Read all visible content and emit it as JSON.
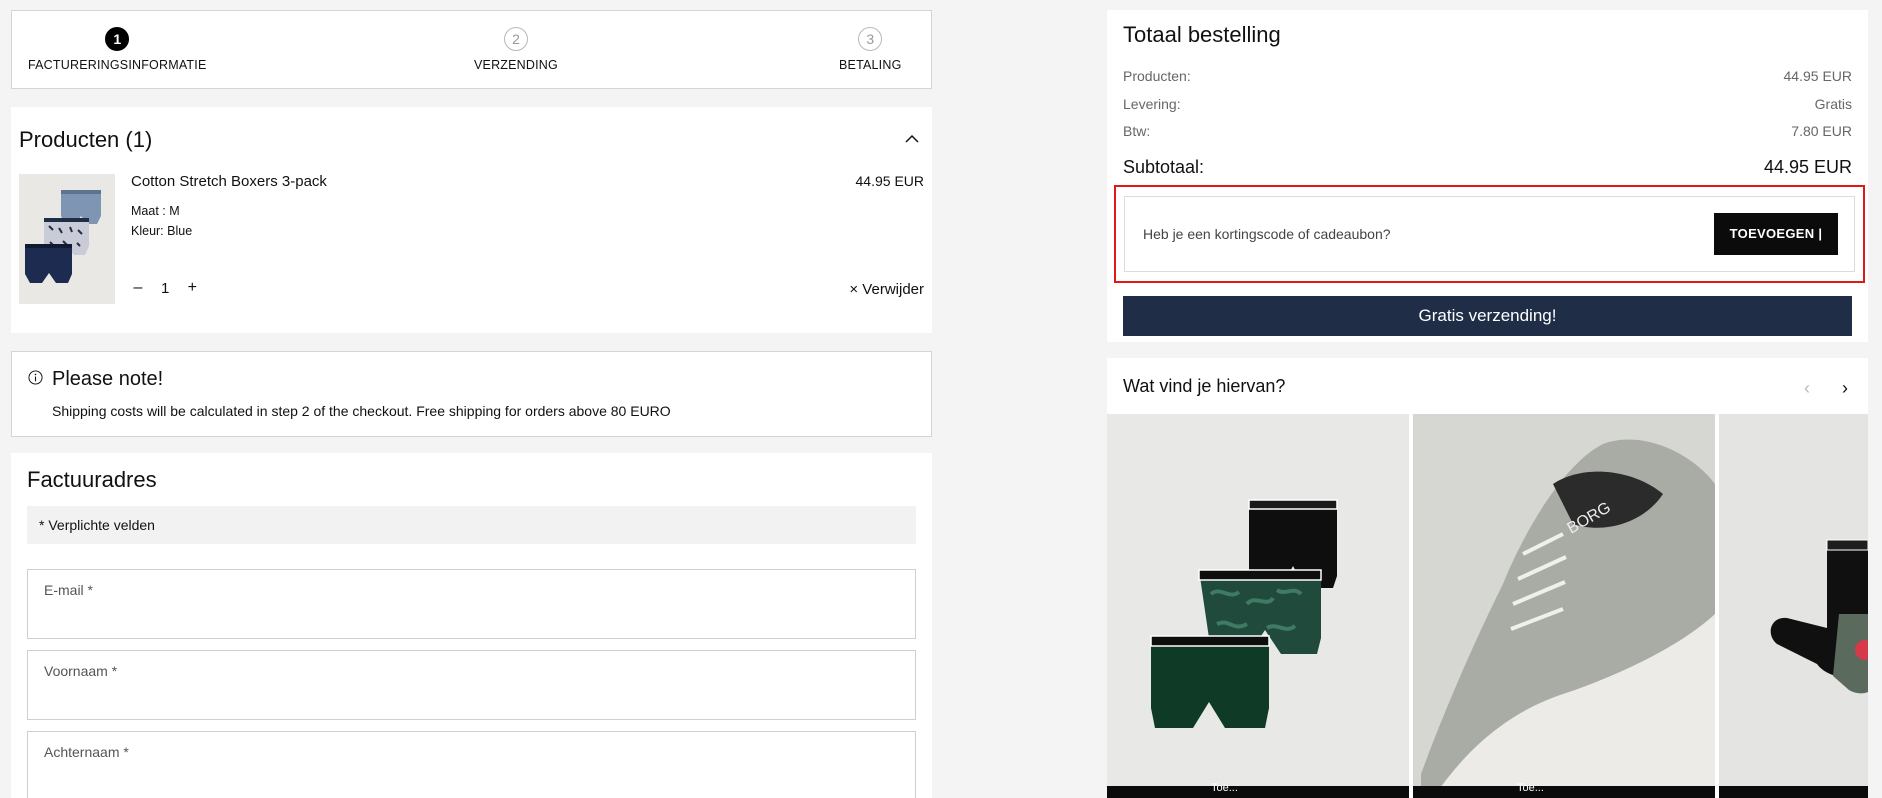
{
  "steps": [
    {
      "num": "1",
      "label": "FACTURERINGSINFORMATIE"
    },
    {
      "num": "2",
      "label": "VERZENDING"
    },
    {
      "num": "3",
      "label": "BETALING"
    }
  ],
  "products": {
    "title": "Producten (1)",
    "item": {
      "name": "Cotton Stretch Boxers 3-pack",
      "price": "44.95 EUR",
      "size": "Maat : M",
      "color": "Kleur: Blue",
      "qty_minus": "–",
      "qty": "1",
      "qty_plus": "+",
      "remove": "× Verwijder"
    }
  },
  "note": {
    "title": "Please note!",
    "body": "Shipping costs will be calculated in step 2 of the checkout. Free shipping for orders above 80 EURO"
  },
  "address": {
    "title": "Factuuradres",
    "required": "* Verplichte velden",
    "fields": [
      "E-mail *",
      "Voornaam *",
      "Achternaam *"
    ]
  },
  "summary": {
    "title": "Totaal bestelling",
    "rows": [
      {
        "label": "Producten:",
        "value": "44.95 EUR"
      },
      {
        "label": "Levering:",
        "value": "Gratis"
      },
      {
        "label": "Btw:",
        "value": "7.80 EUR"
      }
    ],
    "subtotal_label": "Subtotaal:",
    "subtotal_value": "44.95 EUR",
    "coupon_placeholder": "Heb je een kortingscode of cadeaubon?",
    "coupon_button": "TOEVOEGEN  |",
    "shipping_button": "Gratis verzending!"
  },
  "recommendations": {
    "title": "Wat vind je hiervan?",
    "prev": "‹",
    "next": "›",
    "tile_bar": "Toe..."
  },
  "colors": {
    "accent_navy": "#1f2d47",
    "highlight_red": "#e01818",
    "button_black": "#0b0b0b"
  }
}
